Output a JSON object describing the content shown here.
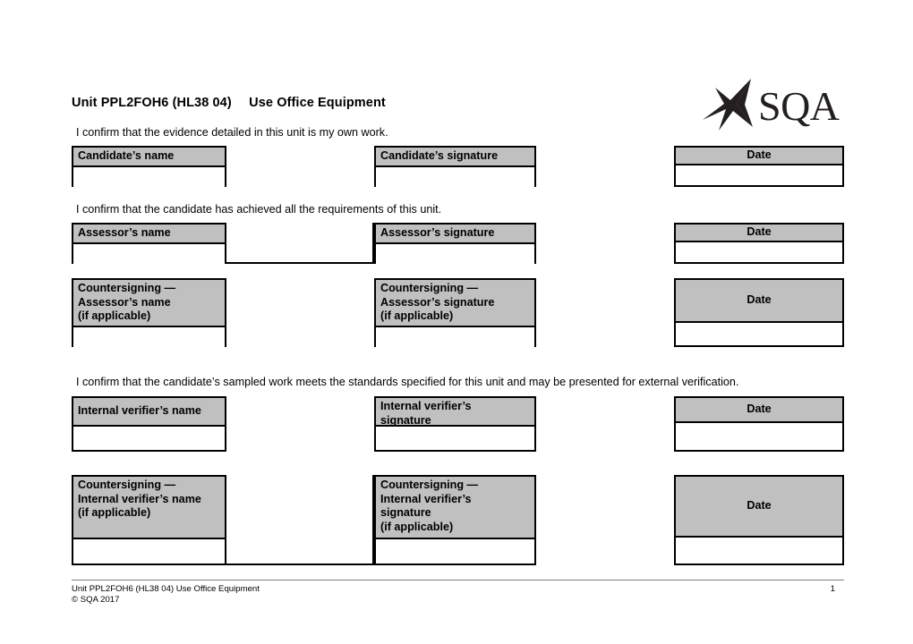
{
  "document": {
    "title": "Unit PPL2FOH6 (HL38 04)\tUse Office Equipment",
    "logo_text": "SQA",
    "logo_icon": "sqa-saltire-logo"
  },
  "statements": {
    "candidate": "I confirm that the evidence detailed in this unit is my own work.",
    "assessor": "I confirm that the candidate has achieved all the requirements of this unit.",
    "internal_verifier": "I confirm that the candidate’s sampled work meets the standards specified for this unit and may be presented for external verification."
  },
  "sections": {
    "candidate": {
      "name_label": "Candidate’s name",
      "signature_label": "Candidate’s signature",
      "date_label": "Date"
    },
    "assessor": {
      "name_label": "Assessor’s name",
      "signature_label": "Assessor’s signature",
      "date_label": "Date"
    },
    "countersigning_assessor": {
      "name_label": "Countersigning —\nAssessor’s name\n(if applicable)",
      "signature_label": "Countersigning —\nAssessor’s signature\n(if applicable)",
      "date_label": "Date"
    },
    "internal_verifier": {
      "name_label": "Internal verifier’s name",
      "signature_label": "Internal verifier’s\nsignature",
      "date_label": "Date"
    },
    "countersigning_internal_verifier": {
      "name_label": "Countersigning —\nInternal verifier’s name\n(if applicable)",
      "signature_label": "Countersigning —\nInternal verifier’s\nsignature\n(if applicable)",
      "date_label": "Date"
    }
  },
  "fields": {
    "candidate_name_value": "",
    "candidate_signature_value": "",
    "candidate_date_value": "",
    "assessor_name_value": "",
    "assessor_signature_value": "",
    "assessor_date_value": "",
    "cs_assessor_name_value": "",
    "cs_assessor_signature_value": "",
    "cs_assessor_date_value": "",
    "iv_name_value": "",
    "iv_signature_value": "",
    "iv_date_value": "",
    "cs_iv_name_value": "",
    "cs_iv_signature_value": "",
    "cs_iv_date_value": ""
  },
  "footer": {
    "left": "Unit PPL2FOH6 (HL38 04) Use Office Equipment",
    "page_number": "1",
    "copyright": "© SQA 2017"
  },
  "colors": {
    "header_fill": "#c0c0c0",
    "border": "#000000",
    "rule": "#808080"
  }
}
